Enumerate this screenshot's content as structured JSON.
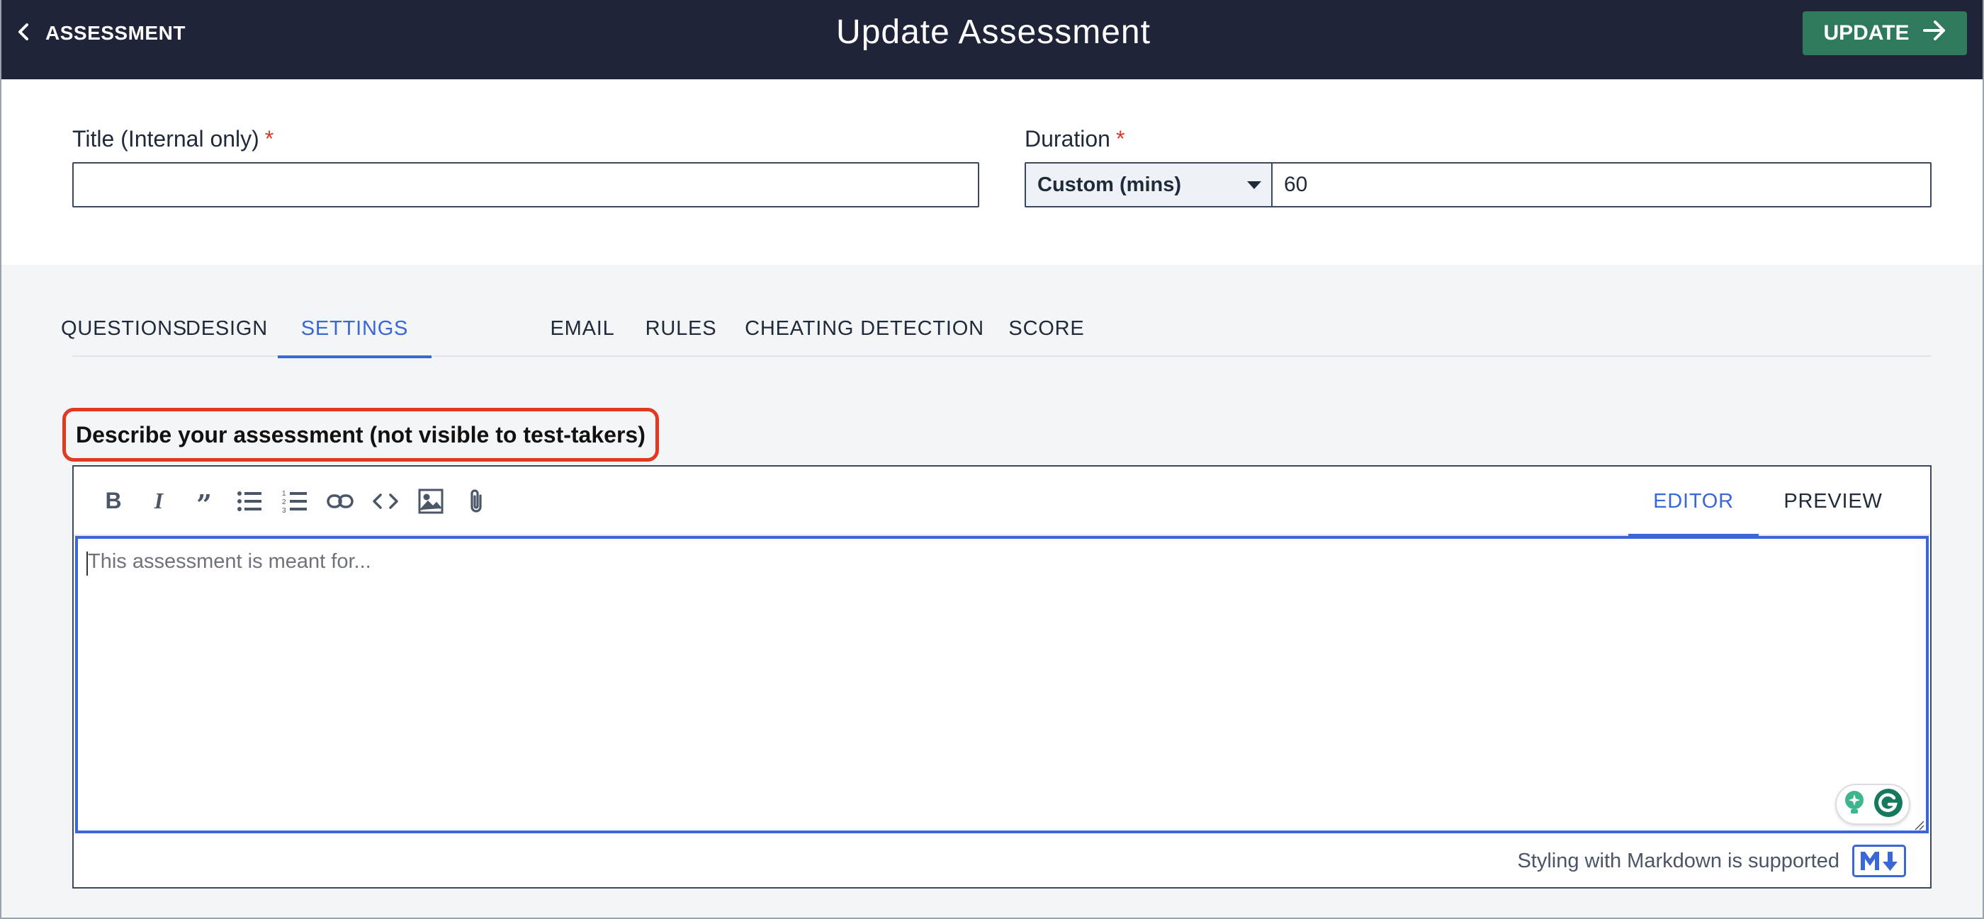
{
  "header": {
    "back_label": "ASSESSMENT",
    "title": "Update Assessment",
    "update_label": "UPDATE"
  },
  "form": {
    "title_label": "Title (Internal only)",
    "title_required": "*",
    "title_value": "",
    "duration_label": "Duration",
    "duration_required": "*",
    "duration_mode": "Custom (mins)",
    "duration_value": "60"
  },
  "tabs": [
    {
      "label": "QUESTIONS",
      "active": false
    },
    {
      "label": "DESIGN",
      "active": false
    },
    {
      "label": "SETTINGS",
      "active": true
    },
    {
      "label": "EMAIL",
      "active": false
    },
    {
      "label": "RULES",
      "active": false
    },
    {
      "label": "CHEATING DETECTION",
      "active": false
    },
    {
      "label": "SCORE",
      "active": false
    }
  ],
  "description": {
    "label": "Describe your assessment (not visible to test-takers)",
    "placeholder": "This assessment is meant for...",
    "value": ""
  },
  "editor": {
    "toolbar_icons": [
      "bold-icon",
      "italic-icon",
      "quote-icon",
      "bulleted-list-icon",
      "numbered-list-icon",
      "link-icon",
      "code-icon",
      "image-icon",
      "attachment-icon"
    ],
    "modes": [
      {
        "label": "EDITOR",
        "active": true
      },
      {
        "label": "PREVIEW",
        "active": false
      }
    ],
    "markdown_note": "Styling with Markdown is supported"
  },
  "colors": {
    "header_bg": "#1f2438",
    "update_btn": "#2f7a5c",
    "accent": "#3a67d6",
    "required": "#d63a2a",
    "highlight_outline": "#e03a22"
  }
}
